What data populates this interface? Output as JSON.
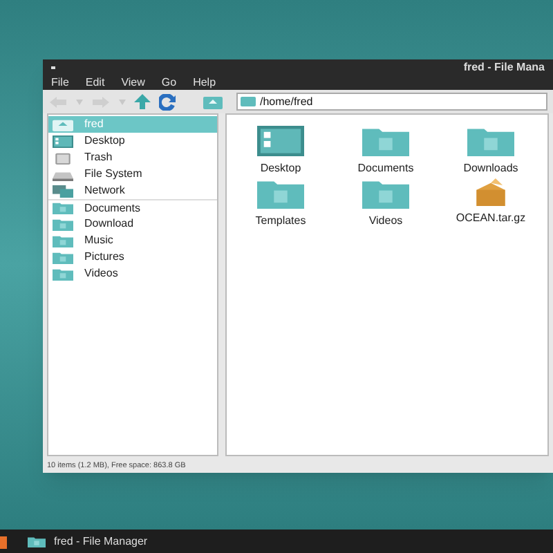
{
  "window": {
    "title": "fred - File Mana"
  },
  "menu": [
    "File",
    "Edit",
    "View",
    "Go",
    "Help"
  ],
  "location": {
    "value": "/home/fred"
  },
  "sidebar": {
    "items": [
      {
        "label": "fred",
        "kind": "home",
        "selected": true
      },
      {
        "label": "Desktop",
        "kind": "desktop",
        "selected": false
      },
      {
        "label": "Trash",
        "kind": "trash",
        "selected": false
      },
      {
        "label": "File System",
        "kind": "drive",
        "selected": false
      },
      {
        "label": "Network",
        "kind": "network",
        "selected": false
      },
      {
        "label": "Documents",
        "kind": "folder",
        "selected": false
      },
      {
        "label": "Download",
        "kind": "folder",
        "selected": false
      },
      {
        "label": "Music",
        "kind": "folder",
        "selected": false
      },
      {
        "label": "Pictures",
        "kind": "folder",
        "selected": false
      },
      {
        "label": "Videos",
        "kind": "folder",
        "selected": false
      }
    ]
  },
  "files": [
    {
      "name": "Desktop",
      "kind": "desktop"
    },
    {
      "name": "Documents",
      "kind": "folder"
    },
    {
      "name": "Downloads",
      "kind": "folder"
    },
    {
      "name": "Templates",
      "kind": "folder"
    },
    {
      "name": "Videos",
      "kind": "folder"
    },
    {
      "name": "OCEAN.tar.gz",
      "kind": "archive"
    }
  ],
  "status_bar": "10 items (1.2 MB), Free space: 863.8 GB",
  "taskbar": {
    "tasks": [
      {
        "label": "fred - File Manager"
      }
    ]
  }
}
